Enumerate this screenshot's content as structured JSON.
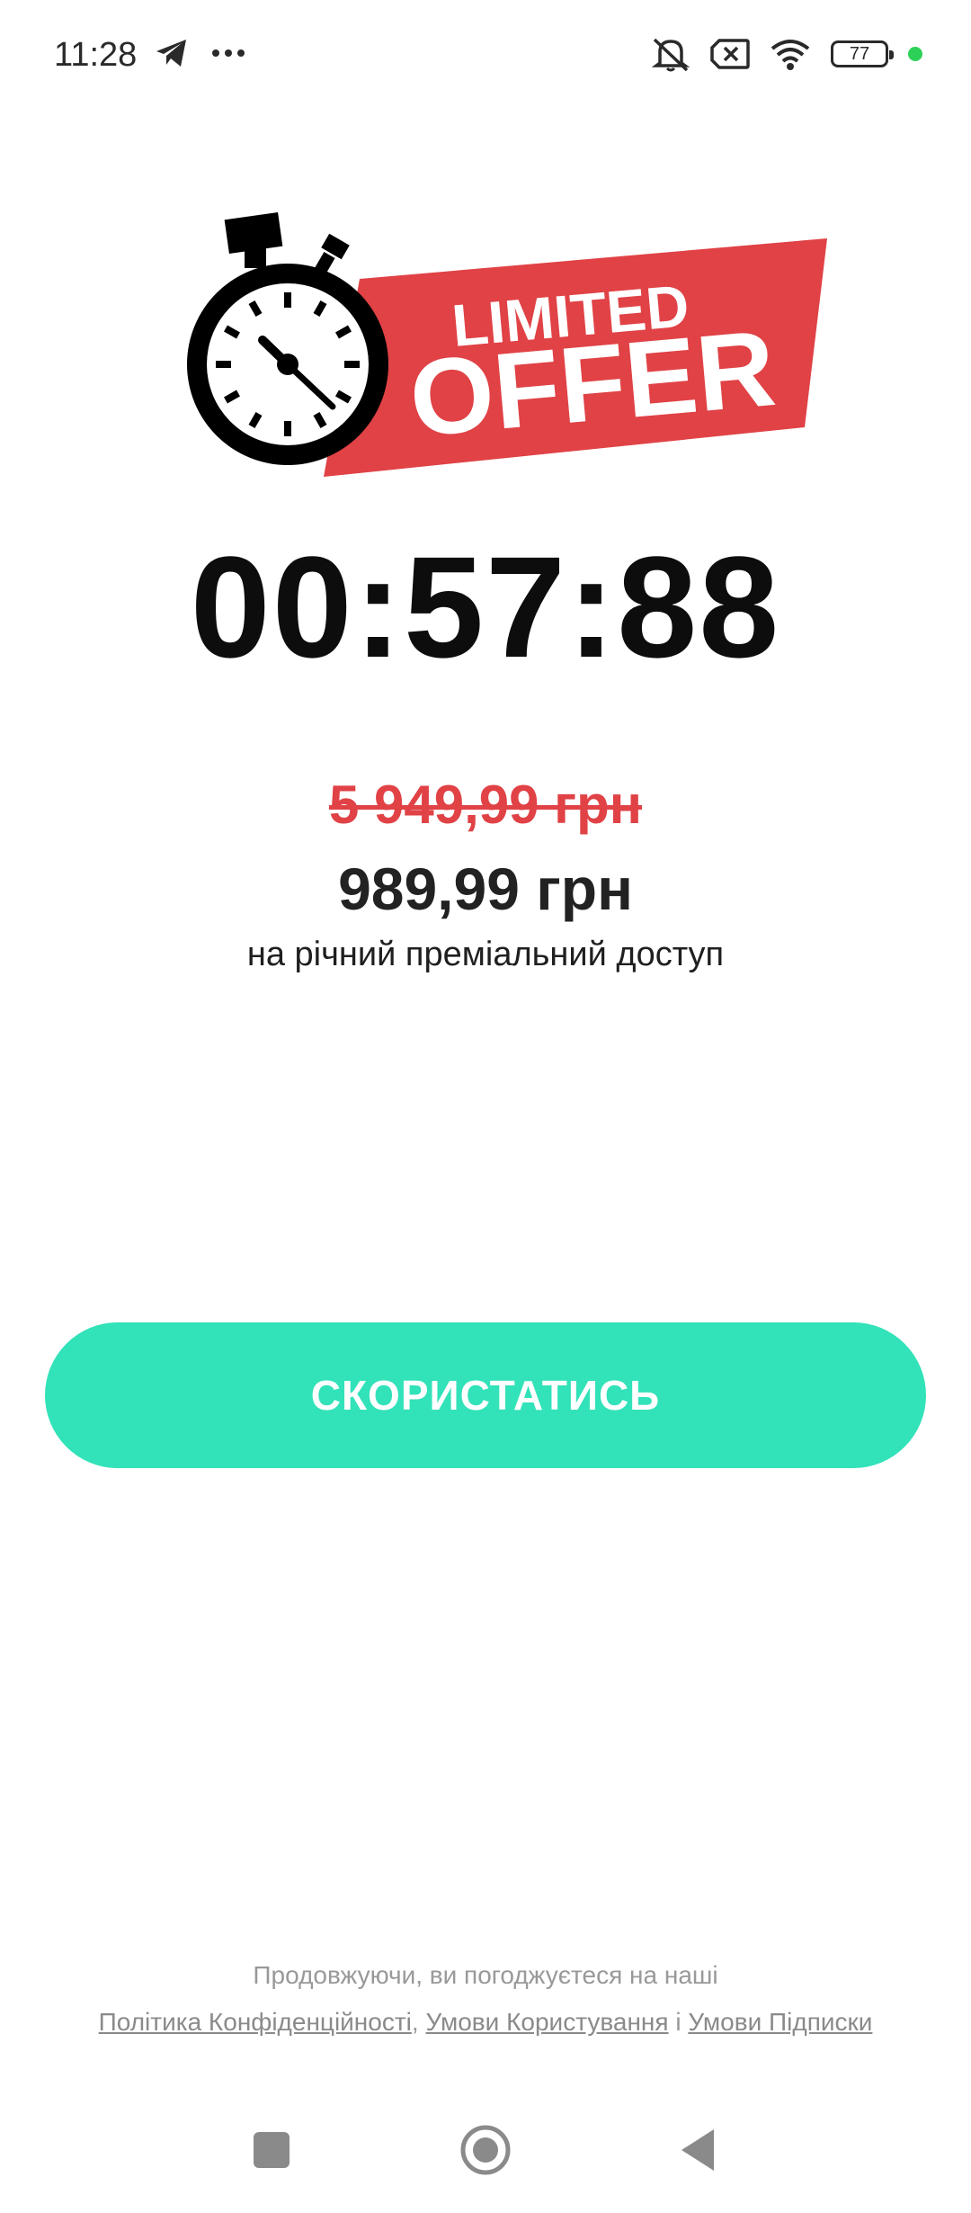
{
  "status_bar": {
    "time": "11:28",
    "battery_level": "77",
    "icons_left": [
      "telegram-icon",
      "more-dots-icon"
    ],
    "icons_right": [
      "bell-muted-icon",
      "sim-x-icon",
      "wifi-icon",
      "battery-icon",
      "status-dot"
    ]
  },
  "hero": {
    "banner_line1": "LIMITED",
    "banner_line2": "OFFER",
    "colors": {
      "banner": "#e04246",
      "stopwatch": "#000000"
    }
  },
  "timer": {
    "value": "00:57:88"
  },
  "pricing": {
    "old_price": "5 949,99 грн",
    "new_price": "989,99 грн",
    "caption": "на річний преміальний доступ"
  },
  "cta": {
    "label": "СКОРИСТАТИСЬ",
    "color": "#32e2b9"
  },
  "legal": {
    "intro": "Продовжуючи, ви погоджуєтеся на наші",
    "privacy": "Політика Конфіденційності",
    "comma": ",",
    "terms": "Умови Користування",
    "and": "і",
    "subscription": "Умови Підписки"
  },
  "nav": {
    "icons": [
      "recents-icon",
      "home-icon",
      "back-icon"
    ]
  }
}
